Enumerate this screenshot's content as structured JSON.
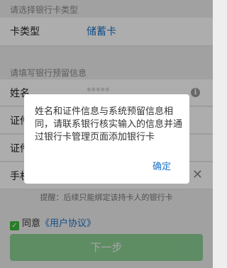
{
  "sections": {
    "card_type_header": "请选择银行卡类型",
    "reserved_info_header": "请填写银行预留信息"
  },
  "card_type_row": {
    "label": "卡类型",
    "value": "储蓄卡"
  },
  "form": {
    "name_label": "姓名",
    "name_value": "*****",
    "id_type_label": "证件类型",
    "id_number_label": "证件号",
    "phone_label": "手机号"
  },
  "tip": "提醒：后续只能绑定该持卡人的银行卡",
  "agreement": {
    "prefix": "同意",
    "link": "《用户协议》",
    "checked": true
  },
  "next_button": "下一步",
  "dialog": {
    "message": "姓名和证件信息与系统预留信息相同，请联系银行核实输入的信息并通过银行卡管理页面添加银行卡",
    "confirm": "确定"
  },
  "colors": {
    "accent": "#1a73c9",
    "primary_button": "#3bb64a",
    "checkbox": "#3fb83c"
  }
}
